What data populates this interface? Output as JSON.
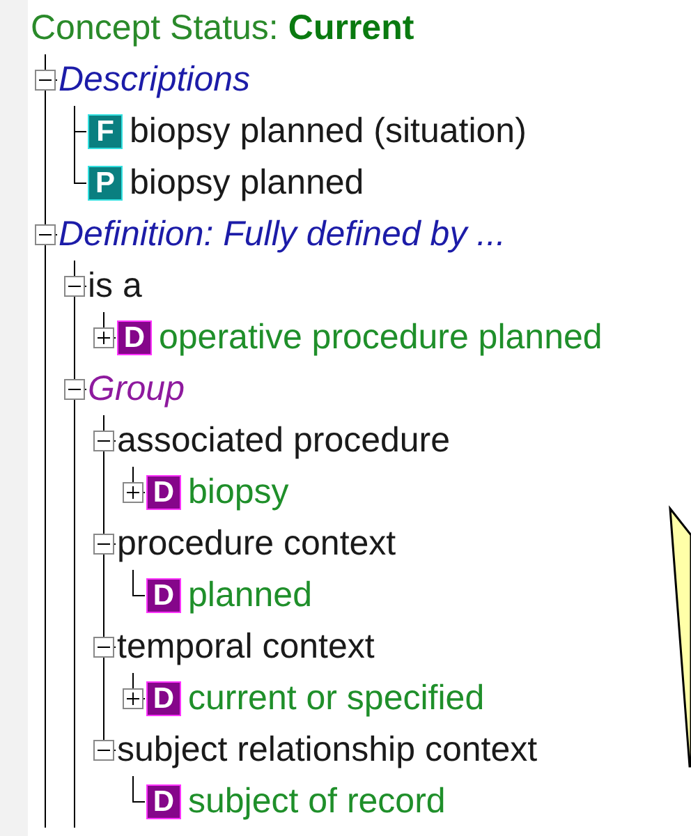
{
  "status": {
    "label": "Concept Status:",
    "value": "Current"
  },
  "tree": [
    {
      "kind": "section",
      "label": "Descriptions",
      "expanded": true,
      "children": [
        {
          "kind": "description",
          "badge": "F",
          "label": "biopsy planned (situation)"
        },
        {
          "kind": "description",
          "badge": "P",
          "label": "biopsy planned"
        }
      ]
    },
    {
      "kind": "section",
      "label": "Definition: Fully defined by ...",
      "expanded": true,
      "more_below": true,
      "children": [
        {
          "kind": "attribute",
          "label": "is a",
          "expanded": true,
          "children": [
            {
              "kind": "concept",
              "badge": "D",
              "label": "operative procedure planned",
              "expanded": false
            }
          ]
        },
        {
          "kind": "group",
          "label": "Group",
          "expanded": true,
          "more_below": true,
          "children": [
            {
              "kind": "attribute",
              "label": "associated procedure",
              "expanded": true,
              "children": [
                {
                  "kind": "concept",
                  "badge": "D",
                  "label": "biopsy",
                  "expanded": false
                }
              ]
            },
            {
              "kind": "attribute",
              "label": "procedure context",
              "expanded": true,
              "children": [
                {
                  "kind": "concept",
                  "badge": "D",
                  "label": "planned"
                }
              ]
            },
            {
              "kind": "attribute",
              "label": "temporal context",
              "expanded": true,
              "children": [
                {
                  "kind": "concept",
                  "badge": "D",
                  "label": "current or specified",
                  "expanded": false
                }
              ]
            },
            {
              "kind": "attribute",
              "label": "subject relationship context",
              "expanded": true,
              "children": [
                {
                  "kind": "concept",
                  "badge": "D",
                  "label": "subject of record"
                }
              ]
            }
          ]
        }
      ]
    }
  ]
}
